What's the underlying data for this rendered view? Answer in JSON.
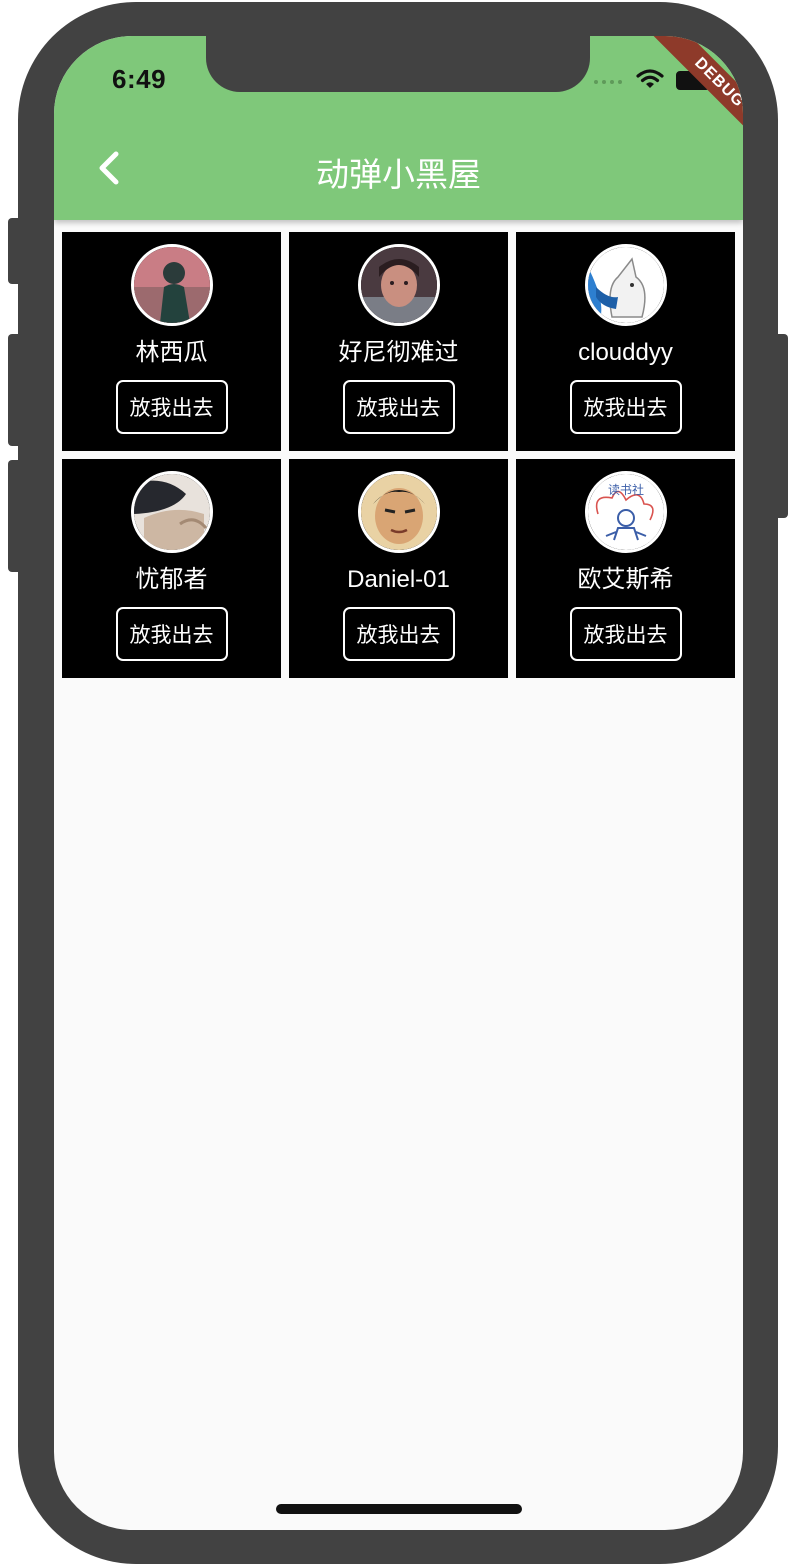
{
  "status_bar": {
    "time": "6:49",
    "debug_label": "DEBUG"
  },
  "app_bar": {
    "title": "动弹小黑屋",
    "back_icon": "chevron-left-icon"
  },
  "colors": {
    "app_bar": "#7fc87a",
    "card": "#000000",
    "background": "#fafafa",
    "debug_banner": "#8e3a2a"
  },
  "users": [
    {
      "name": "林西瓜",
      "button": "放我出去"
    },
    {
      "name": "好尼彻难过",
      "button": "放我出去"
    },
    {
      "name": "clouddyy",
      "button": "放我出去"
    },
    {
      "name": "忧郁者",
      "button": "放我出去"
    },
    {
      "name": "Daniel-01",
      "button": "放我出去"
    },
    {
      "name": "欧艾斯希",
      "button": "放我出去"
    }
  ]
}
